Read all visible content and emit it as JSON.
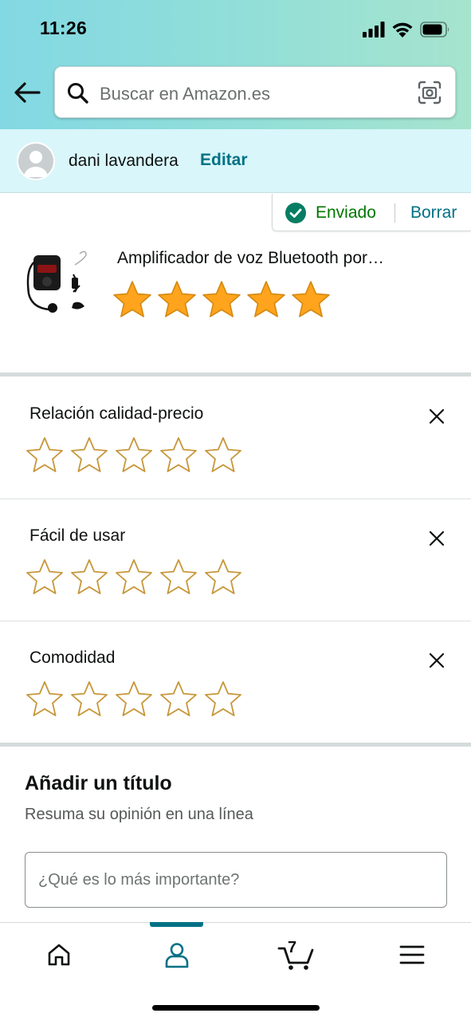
{
  "status_bar": {
    "time": "11:26"
  },
  "search": {
    "placeholder": "Buscar en Amazon.es"
  },
  "user": {
    "name": "dani lavandera",
    "edit_label": "Editar"
  },
  "submission": {
    "status_label": "Enviado",
    "delete_label": "Borrar",
    "status_color": "#007600"
  },
  "product": {
    "title": "Amplificador de voz Bluetooth por…",
    "overall_rating": 5,
    "max_rating": 5
  },
  "attribute_ratings": [
    {
      "label": "Relación calidad-precio",
      "rating": 0
    },
    {
      "label": "Fácil de usar",
      "rating": 0
    },
    {
      "label": "Comodidad",
      "rating": 0
    }
  ],
  "title_section": {
    "heading": "Añadir un título",
    "subtitle": "Resuma su opinión en una línea",
    "input_placeholder": "¿Qué es lo más importante?",
    "input_value": ""
  },
  "bottom_nav": {
    "items": [
      {
        "icon": "home-icon",
        "active": false
      },
      {
        "icon": "account-icon",
        "active": true
      },
      {
        "icon": "cart-icon",
        "active": false,
        "badge": "7"
      },
      {
        "icon": "menu-icon",
        "active": false
      }
    ]
  },
  "colors": {
    "accent": "#007185",
    "star_fill": "#ffa41c",
    "star_outline": "#c7973a",
    "success": "#007600"
  }
}
